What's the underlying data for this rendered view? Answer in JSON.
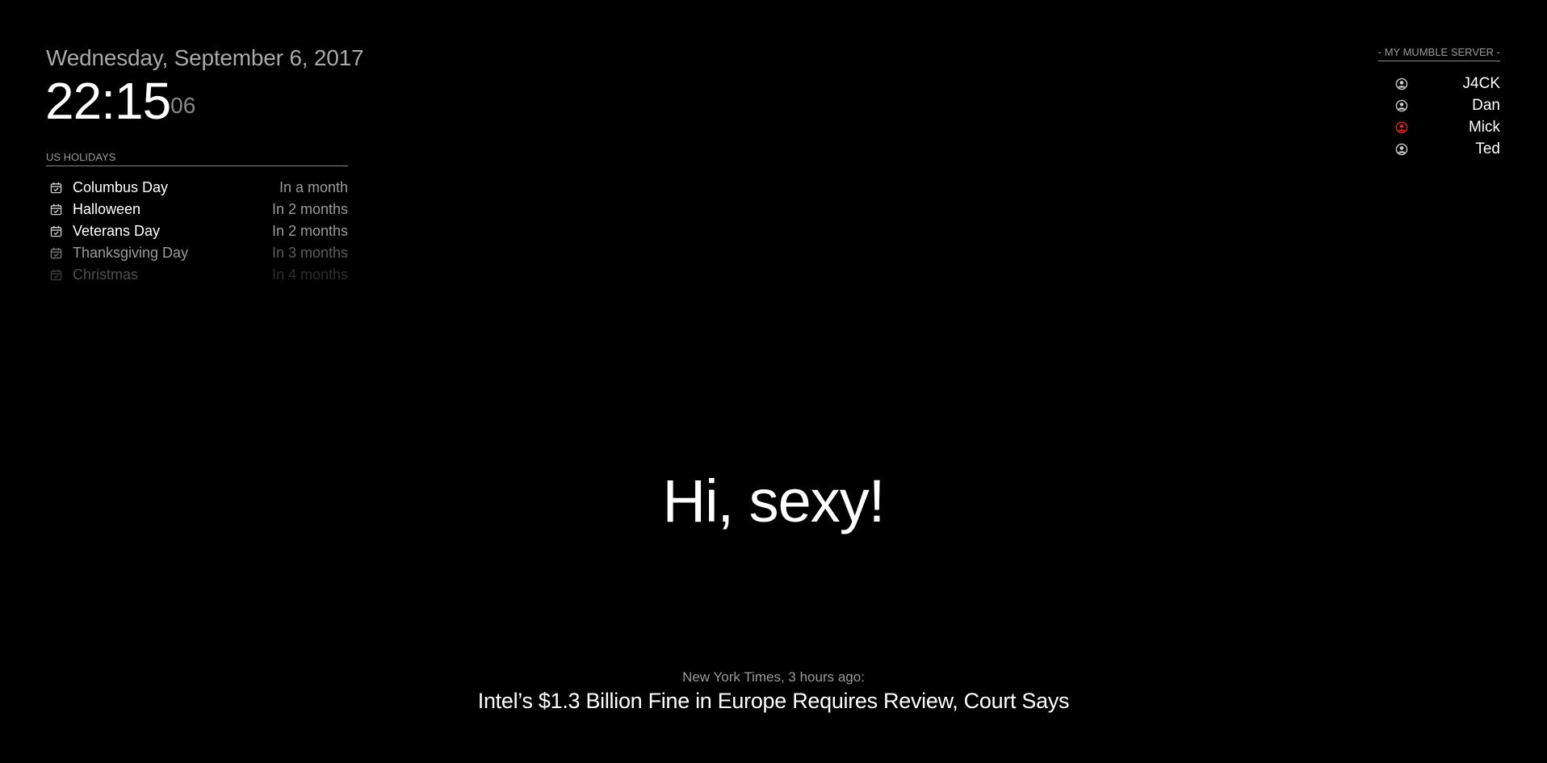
{
  "clock": {
    "date": "Wednesday, September 6, 2017",
    "time": "22:15",
    "seconds": "06"
  },
  "calendar": {
    "header": "US HOLIDAYS",
    "events": [
      {
        "title": "Columbus Day",
        "when": "In a month",
        "icon": "calendar-check-icon"
      },
      {
        "title": "Halloween",
        "when": "In 2 months",
        "icon": "calendar-check-icon"
      },
      {
        "title": "Veterans Day",
        "when": "In 2 months",
        "icon": "calendar-check-icon"
      },
      {
        "title": "Thanksgiving Day",
        "when": "In 3 months",
        "icon": "calendar-check-icon"
      },
      {
        "title": "Christmas",
        "when": "In 4 months",
        "icon": "calendar-check-icon"
      }
    ]
  },
  "mumble": {
    "header": "- MY MUMBLE SERVER -",
    "users": [
      {
        "name": "J4CK",
        "icon": "user-circle-icon",
        "status_color": "#cccccc"
      },
      {
        "name": "Dan",
        "icon": "user-circle-icon",
        "status_color": "#cccccc"
      },
      {
        "name": "Mick",
        "icon": "user-circle-icon",
        "status_color": "#e0211f"
      },
      {
        "name": "Ted",
        "icon": "user-circle-icon",
        "status_color": "#cccccc"
      }
    ]
  },
  "compliment": "Hi, sexy!",
  "news": {
    "source": "New York Times, 3 hours ago:",
    "headline": "Intel’s $1.3 Billion Fine in Europe Requires Review, Court Says"
  },
  "colors": {
    "background": "#000000",
    "primary_text": "#ffffff",
    "dimmed_text": "#9a9a9a",
    "alert": "#e0211f"
  }
}
